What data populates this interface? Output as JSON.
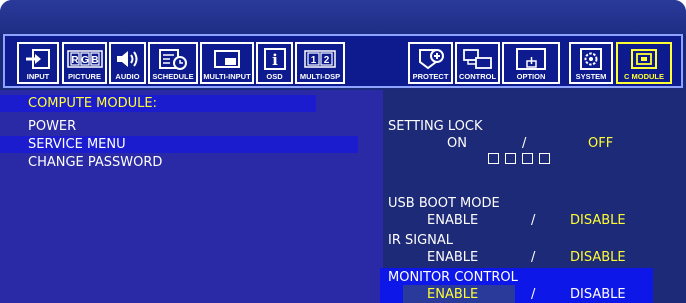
{
  "tabs": [
    {
      "label": "INPUT",
      "icon": "input-icon"
    },
    {
      "label": "PICTURE",
      "icon": "rgb-icon"
    },
    {
      "label": "AUDIO",
      "icon": "speaker-icon"
    },
    {
      "label": "SCHEDULE",
      "icon": "schedule-icon"
    },
    {
      "label": "MULTI-INPUT",
      "icon": "multi-input-icon"
    },
    {
      "label": "OSD",
      "icon": "info-icon"
    },
    {
      "label": "MULTI-DSP",
      "icon": "multi-display-icon"
    },
    {
      "label": "PROTECT",
      "icon": "shield-icon"
    },
    {
      "label": "CONTROL",
      "icon": "control-icon"
    },
    {
      "label": "OPTION",
      "icon": "option-icon"
    },
    {
      "label": "SYSTEM",
      "icon": "gear-icon"
    },
    {
      "label": "C MODULE",
      "icon": "compute-module-icon"
    }
  ],
  "icon_text": {
    "rgb": [
      "R",
      "G",
      "B"
    ],
    "osd": "i",
    "multi_dsp": [
      "1",
      "2"
    ]
  },
  "menu": {
    "heading": "COMPUTE MODULE:",
    "items": [
      "POWER",
      "SERVICE MENU",
      "CHANGE PASSWORD"
    ]
  },
  "settings": {
    "setting_lock": {
      "label": "SETTING LOCK",
      "on": "ON",
      "sep": "/",
      "off": "OFF",
      "selected": "OFF"
    },
    "usb_boot_mode": {
      "label": "USB BOOT MODE",
      "enable": "ENABLE",
      "sep": "/",
      "disable": "DISABLE",
      "selected": "DISABLE"
    },
    "ir_signal": {
      "label": "IR SIGNAL",
      "enable": "ENABLE",
      "sep": "/",
      "disable": "DISABLE",
      "selected": "DISABLE"
    },
    "monitor_control": {
      "label": "MONITOR CONTROL",
      "enable": "ENABLE",
      "sep": "/",
      "disable": "DISABLE",
      "selected": "ENABLE"
    }
  },
  "colors": {
    "accent_yellow": "#ffff33",
    "panel_blue": "#2a2aa6",
    "highlight_blue": "#0d18e8"
  }
}
